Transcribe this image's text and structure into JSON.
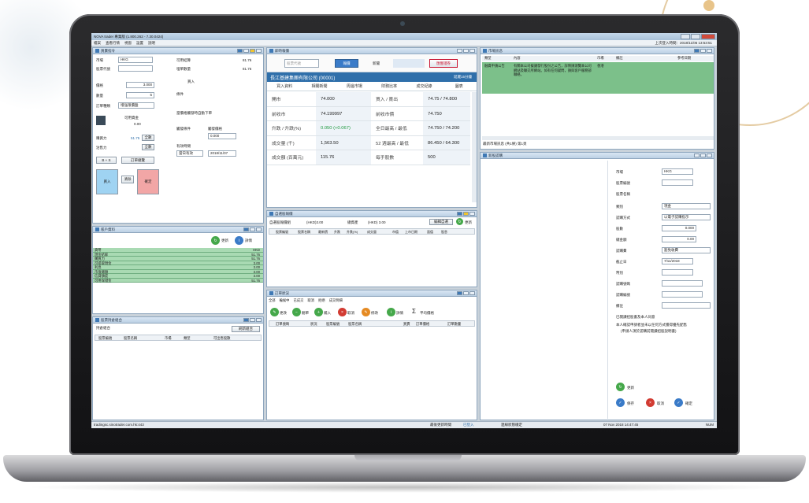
{
  "app": {
    "title": "NOVA trader 專業版 (1.800.262 - 7.30.0424)",
    "menu": [
      "檔案",
      "查看行情",
      "視窗",
      "設置",
      "說明"
    ],
    "account_info": "上次登入時間：2018/11/06 13:53:51"
  },
  "order_panel": {
    "title": "買賣指令",
    "fields": {
      "market_label": "市場",
      "market_value": "HKG",
      "code_label": "股票代號",
      "price_label": "價格",
      "price_value": "3.000",
      "qty_label": "數量",
      "qty_value": "5",
      "order_type_label": "訂單種類",
      "order_type_value": "增強限價盤",
      "available_label": "可用資金",
      "available_value": "0.00",
      "buy_power_label": "購買力",
      "buy_power_value": "51.75",
      "all_label": "全數",
      "sell_label": "沽售力",
      "settlement_label": "可用結算",
      "settlement_value": "81.76",
      "side_label": "買入",
      "extra_label": "埋單數量",
      "trigger_label": "觸發條件",
      "trigger_price_label": "觸發價格",
      "trigger_value": "0.000",
      "valid_label": "有效時間",
      "valid_date": "2018/11/07",
      "valid_value": "當日有效",
      "condition_label": "條件",
      "buy_btn": "買入",
      "sell_btn": "沽出",
      "confirm_btn": "確定",
      "clear_btn": "清除",
      "order_detail_btn": "訂單總覽",
      "spread_btn": "B + S",
      "checkbox_label": "當價格觸發時自動下單"
    }
  },
  "account_panel": {
    "title": "賬戶資料",
    "refresh": "更新",
    "detail": "詳情",
    "rows": [
      {
        "label": "貨幣",
        "value": "HKD"
      },
      {
        "label": "現金結餘",
        "value": "51.76"
      },
      {
        "label": "購買力",
        "value": "51.76"
      },
      {
        "label": "可提取現金",
        "value": "3.00"
      },
      {
        "label": "利息",
        "value": "3.00"
      },
      {
        "label": "市值總額",
        "value": "3.00"
      },
      {
        "label": "信貸額度",
        "value": "3.00"
      },
      {
        "label": "可用保證金",
        "value": "51.76"
      }
    ]
  },
  "portfolio_panel": {
    "title": "股票持倉組合",
    "sub": "持倉組合",
    "refresh": "刷新組合",
    "cols": [
      "股票編號",
      "股票名稱",
      "市場",
      "類型",
      "可出售股數"
    ]
  },
  "quote_panel": {
    "title": "即時報價",
    "search_placeholder": "股票代號",
    "tab_quote": "報價",
    "company": "長江基建集團有限公司 (00001)",
    "status": "延遲15分鐘",
    "sub_tabs": [
      "買入資料",
      "相關新聞",
      "周邊市場",
      "財務比率",
      "成交紀錄",
      "圖表"
    ],
    "rows": [
      {
        "l": "開市",
        "v": "74.000",
        "l2": "買入 / 賣出",
        "v2": "74.75 / 74.800"
      },
      {
        "l": "前收市",
        "v": "74.199997",
        "l2": "前收市價",
        "v2": "74.750"
      },
      {
        "l": "升跌 / 升跌(%)",
        "v": "0.050 (+0.067)",
        "l2": "全日最高 / 最低",
        "v2": "74.750 / 74.200"
      },
      {
        "l": "成交量 (千)",
        "v": "1,563.50",
        "l2": "52 週最高 / 最低",
        "v2": "86.450 / 64.300"
      },
      {
        "l": "成交額 (百萬元)",
        "v": "115.76",
        "l2": "每手股數",
        "v2": "500"
      }
    ],
    "partner_label": "新聞",
    "partner_btn": "匯豐證券"
  },
  "watch_panel": {
    "title": "自選股報價",
    "label1": "自選股報價組",
    "val1": "(HKD)3.00",
    "label2": "總資產",
    "val2": "(HKD) 3.00",
    "edit_btn": "編輯自選",
    "refresh_btn": "更新",
    "cols": [
      "股票編號",
      "股票名稱",
      "最新價",
      "升跌",
      "升跌(%)",
      "成交量",
      "市值",
      "上市日期",
      "面值",
      "股息"
    ]
  },
  "orders_panel": {
    "title": "訂單狀況",
    "tabs": [
      "全部",
      "輪候中",
      "已成交",
      "取消",
      "拒絕",
      "成交明細"
    ],
    "actions": [
      "更改",
      "刪單",
      "補入",
      "取消",
      "修改",
      "詳情",
      "平均價格"
    ],
    "cols": [
      "訂單號碼",
      "狀況",
      "股票編號",
      "股票名稱",
      "買賣",
      "訂單價格",
      "訂單數量"
    ]
  },
  "news_panel": {
    "title": "市場訊息",
    "cols": [
      "類型",
      "內容",
      "市場",
      "備註",
      "參考日期"
    ],
    "row_type": "融資申請公告",
    "row_text": "有關本公司擬議發行股份之公告，詳情請瀏覽本公司網站及聯交所網站。如有任何疑問，請與客戶服務部聯絡。",
    "row_market": "香港",
    "footer": "最新市場訊息 (共1條) 第1頁"
  },
  "ipo_panel": {
    "title": "新股認購",
    "fields": [
      {
        "label": "市場",
        "value": "HKG"
      },
      {
        "label": "股票編號",
        "value": ""
      },
      {
        "label": "股票名稱",
        "value": ""
      },
      {
        "label": "類別",
        "value": "現金"
      },
      {
        "label": "認購方式",
        "value": "以電子認購指示"
      },
      {
        "label": "股數",
        "value": "0.000"
      },
      {
        "label": "總金額",
        "value": "0.00"
      },
      {
        "label": "認購費",
        "value": "豁免收費"
      },
      {
        "label": "截止日",
        "value": "7/11/2018"
      },
      {
        "label": "幣別",
        "value": ""
      },
      {
        "label": "認購號碼",
        "value": ""
      },
      {
        "label": "認購編號",
        "value": ""
      },
      {
        "label": "備註",
        "value": ""
      }
    ],
    "check1": "已閱讀招股書及本人同意",
    "check2": "本人確認申請者並未以任何方式獲得優先配售",
    "check3": "(申請人須於認購前閱讀招股說明書)",
    "submit": "更新",
    "btn_save": "保存",
    "btn_cancel": "取消",
    "btn_confirm": "確定"
  },
  "status": {
    "left": "tradingsc.sinotrader.com.hk:443",
    "mid1": "最後更新時間",
    "mid2": "已登入",
    "mid3": "連線狀態穩定",
    "datetime": "07 Nov 2018 14:47:45",
    "right": "NUM"
  },
  "colors": {
    "accent": "#2f6faa",
    "green_band": "#7cc08a",
    "buy": "#9fd3f2",
    "sell": "#f2a6a6"
  }
}
